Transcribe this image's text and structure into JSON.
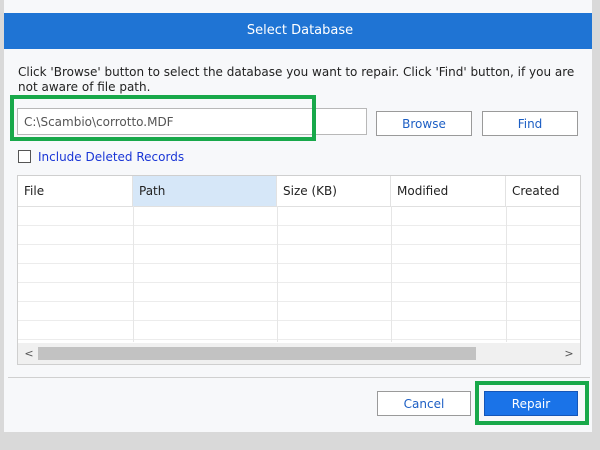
{
  "dialog": {
    "title": "Select Database",
    "description": "Click 'Browse' button to select the database you want to repair. Click 'Find' button, if you are not aware of file path."
  },
  "path_input": {
    "value": "C:\\Scambio\\corrotto.MDF"
  },
  "buttons": {
    "browse": "Browse",
    "find": "Find",
    "cancel": "Cancel",
    "repair": "Repair"
  },
  "checkbox": {
    "label": "Include Deleted Records",
    "checked": false
  },
  "table": {
    "columns": [
      "File",
      "Path",
      "Size (KB)",
      "Modified",
      "Created"
    ],
    "selected_column": "Path",
    "rows": []
  },
  "scrollbar": {
    "left_arrow": "<",
    "right_arrow": ">"
  },
  "colors": {
    "title_bar": "#1f74d4",
    "highlight": "#18a84a",
    "repair_button": "#1a73e8",
    "link_blue": "#1a36d6"
  }
}
